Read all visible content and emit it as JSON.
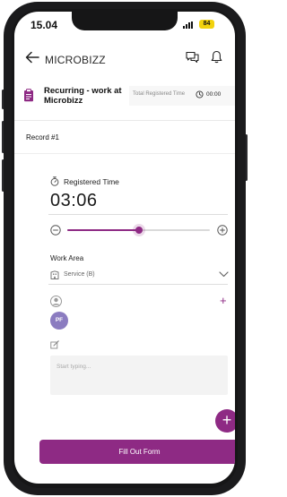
{
  "status_bar": {
    "time": "15.04",
    "battery": "84"
  },
  "header": {
    "title": "MICROBIZZ"
  },
  "task": {
    "title": "Recurring - work at Microbizz",
    "total_label": "Total Registered Time",
    "total_value": "00:00"
  },
  "record": {
    "label": "Record #1"
  },
  "registered_time": {
    "label": "Registered Time",
    "value": "03:06",
    "slider_fraction": 0.5
  },
  "work_area": {
    "label": "Work Area",
    "value": "Service (B)"
  },
  "participants": {
    "add_symbol": "+",
    "avatar_initials": "PF"
  },
  "notes": {
    "placeholder": "Start typing..."
  },
  "fab": {
    "symbol": "+"
  },
  "submit": {
    "label": "Fill Out Form"
  },
  "colors": {
    "accent": "#8e2a84",
    "avatar": "#8b7cc0",
    "battery": "#f2d20e"
  }
}
